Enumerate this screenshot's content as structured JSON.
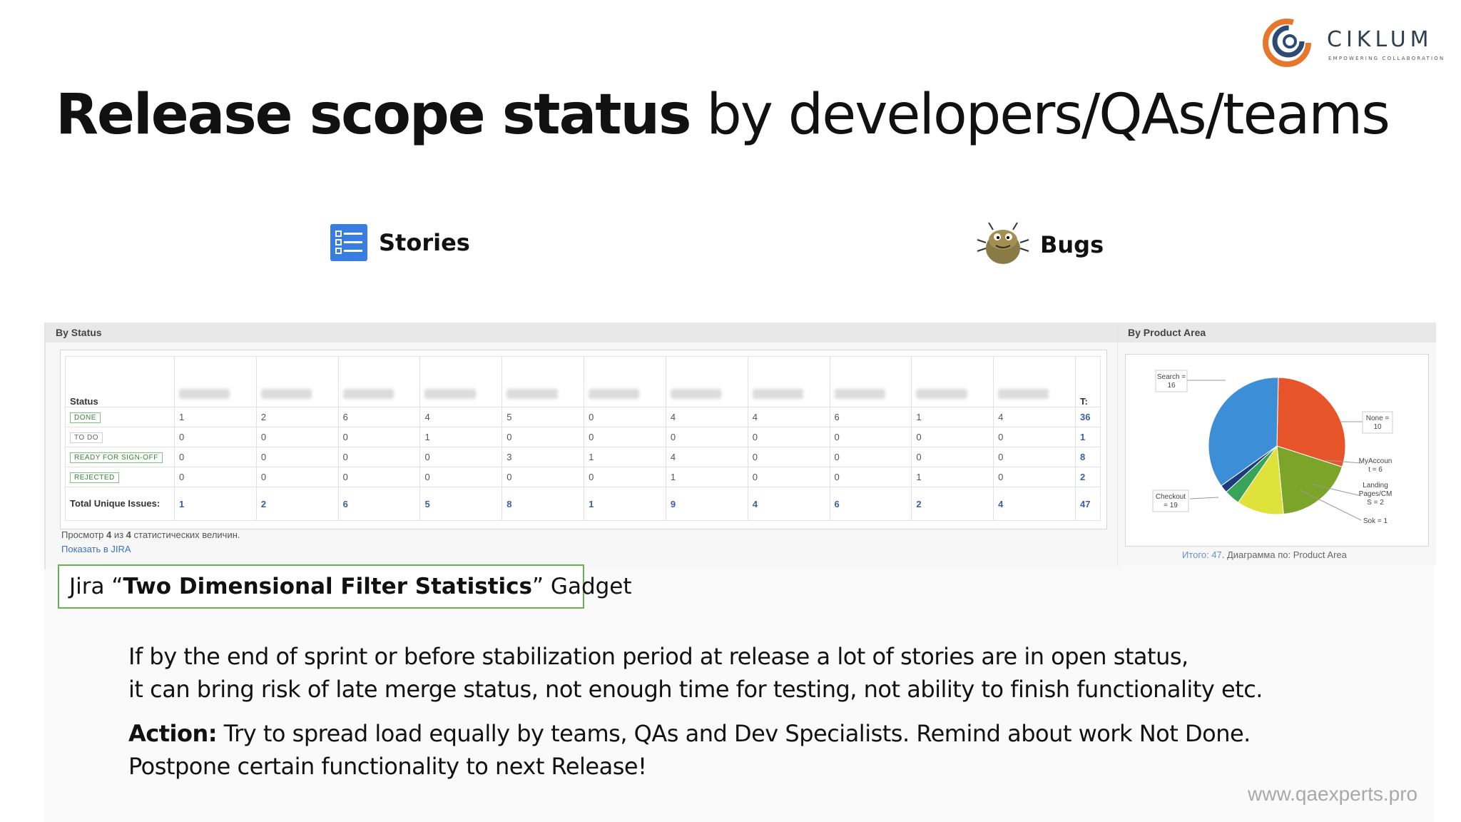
{
  "brand": {
    "name": "CIKLUM",
    "tagline": "EMPOWERING COLLABORATION"
  },
  "title": {
    "bold": "Release scope status",
    "rest": " by developers/QAs/teams"
  },
  "sections": {
    "stories": "Stories",
    "bugs": "Bugs"
  },
  "status_panel": {
    "header": "By Status",
    "status_col": "Status",
    "total_col": "T:",
    "rows": [
      {
        "status": "DONE",
        "values": [
          "1",
          "2",
          "6",
          "4",
          "5",
          "0",
          "4",
          "4",
          "6",
          "1",
          "4"
        ],
        "total": "36"
      },
      {
        "status": "TO DO",
        "values": [
          "0",
          "0",
          "0",
          "1",
          "0",
          "0",
          "0",
          "0",
          "0",
          "0",
          "0"
        ],
        "total": "1"
      },
      {
        "status": "READY FOR SIGN-OFF",
        "values": [
          "0",
          "0",
          "0",
          "0",
          "3",
          "1",
          "4",
          "0",
          "0",
          "0",
          "0"
        ],
        "total": "8"
      },
      {
        "status": "REJECTED",
        "values": [
          "0",
          "0",
          "0",
          "0",
          "0",
          "0",
          "1",
          "0",
          "0",
          "1",
          "0"
        ],
        "total": "2"
      }
    ],
    "total_row": {
      "label": "Total Unique Issues:",
      "values": [
        "1",
        "2",
        "6",
        "5",
        "8",
        "1",
        "9",
        "4",
        "6",
        "2",
        "4"
      ],
      "total": "47"
    },
    "summary": {
      "prefix": "Просмотр ",
      "shown": "4",
      "mid": " из ",
      "count": "4",
      "suffix": " статистических величин."
    },
    "link": "Показать в JIRA"
  },
  "area_panel": {
    "header": "By Product Area",
    "footer_link": "Итого: 47",
    "footer_rest": ". Диаграмма по: Product Area"
  },
  "chart_data": {
    "type": "pie",
    "slices": [
      {
        "label": "Search",
        "value": 16,
        "color": "#e8542a"
      },
      {
        "label": "None",
        "value": 10,
        "color": "#7ba428"
      },
      {
        "label": "MyAccount",
        "value": 6,
        "color": "#dfe23a"
      },
      {
        "label": "Landing Pages/CM",
        "value": 2,
        "color": "#3aa35a"
      },
      {
        "label": "Sok",
        "value": 1,
        "color": "#1c3c7c"
      },
      {
        "label": "Checkout",
        "value": 19,
        "color": "#3c8ed6"
      }
    ],
    "labels": {
      "search": [
        "Search =",
        "16"
      ],
      "none": [
        "None =",
        "10"
      ],
      "myaccount": [
        "MyAccoun",
        "t = 6"
      ],
      "landing": [
        "Landing",
        "Pages/CM",
        "S = 2"
      ],
      "sok": [
        "Sok = 1"
      ],
      "checkout": [
        "Checkout",
        "= 19"
      ]
    }
  },
  "gadget": {
    "prefix": "Jira “",
    "bold": "Two Dimensional Filter Statistics",
    "suffix": "” Gadget"
  },
  "body": {
    "line1": "If by the end of sprint or before stabilization period at release a lot of stories are in open status,",
    "line2": "it can bring risk of late merge status, not enough time for testing, not ability to finish functionality etc.",
    "action_label": "Action:",
    "action_text": " Try to spread load equally by teams, QAs and Dev Specialists. Remind about work Not Done.",
    "action_line2": "Postpone certain functionality to next Release!"
  },
  "footer_url": "www.qaexperts.pro"
}
